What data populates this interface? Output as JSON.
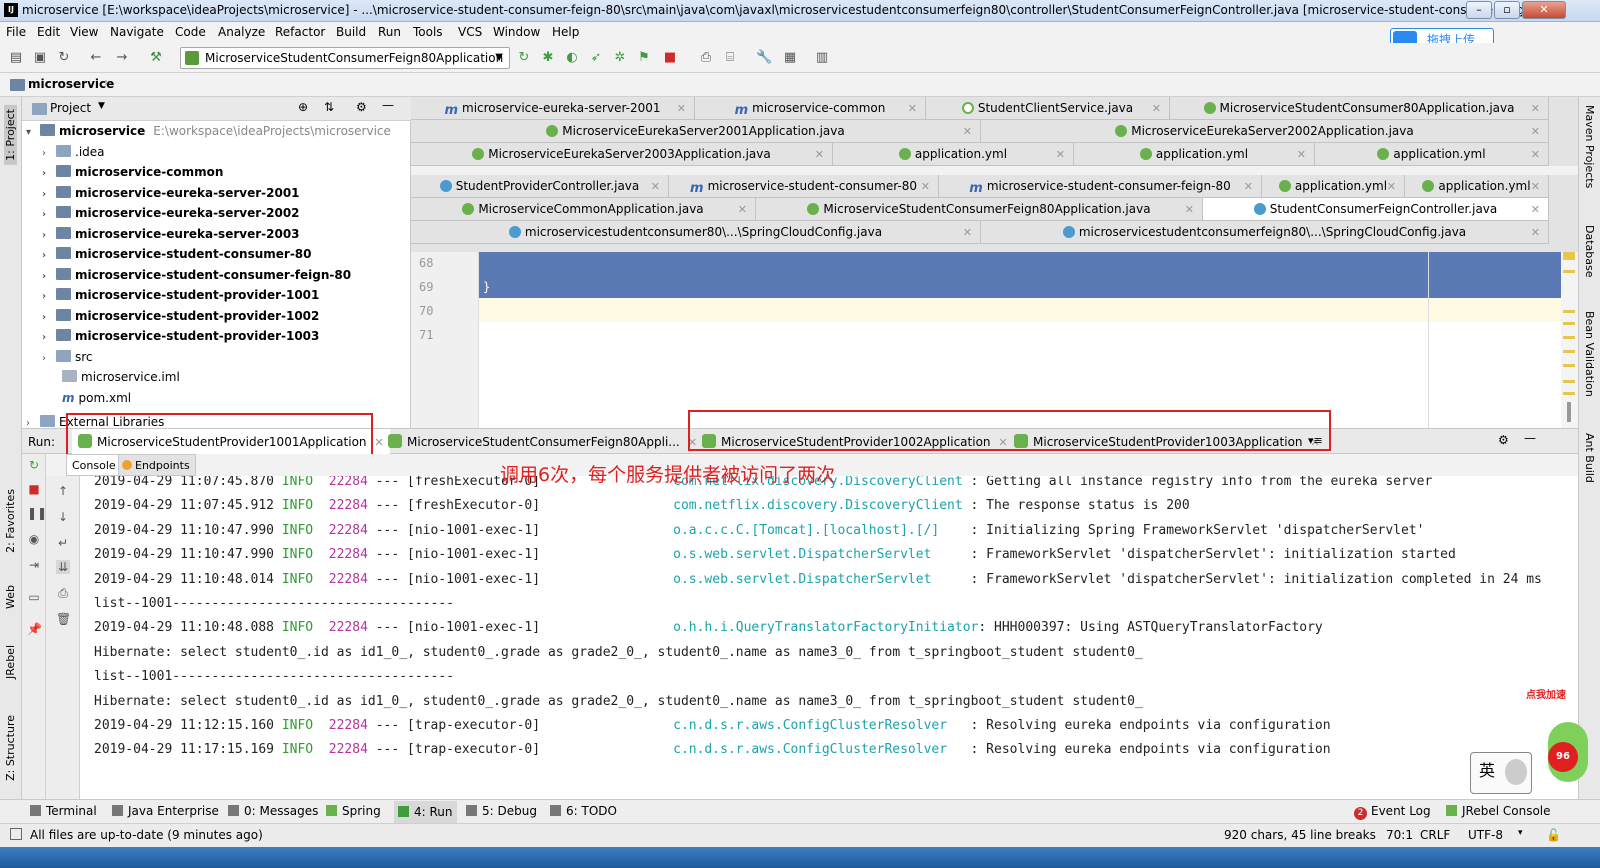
{
  "window": {
    "title": "microservice [E:\\workspace\\ideaProjects\\microservice] - ...\\microservice-student-consumer-feign-80\\src\\main\\java\\com\\javaxl\\microservicestudentconsumerfeign80\\controller\\StudentConsumerFeignController.java [microservice-student-consumer-feign...",
    "controls": {
      "minimize": "–",
      "restore": "▫",
      "close": "✕"
    }
  },
  "menu": [
    "File",
    "Edit",
    "View",
    "Navigate",
    "Code",
    "Analyze",
    "Refactor",
    "Build",
    "Run",
    "Tools",
    "VCS",
    "Window",
    "Help"
  ],
  "upload_button": "拖拽上传",
  "toolbar": {
    "run_config": "MicroserviceStudentConsumerFeign80Application"
  },
  "breadcrumb": "microservice",
  "left_strip": {
    "project": "1: Project",
    "favorites": "2: Favorites",
    "web": "Web",
    "jrebel": "JRebel",
    "structure": "Z: Structure"
  },
  "right_strip": {
    "maven": "Maven Projects",
    "database": "Database",
    "bean": "Bean Validation",
    "ant": "Ant Build"
  },
  "project_panel": {
    "title": "Project",
    "root": {
      "name": "microservice",
      "path": "E:\\workspace\\ideaProjects\\microservice"
    },
    "items": [
      {
        "name": ".idea",
        "bold": false,
        "expandable": true
      },
      {
        "name": "microservice-common",
        "bold": true,
        "expandable": true
      },
      {
        "name": "microservice-eureka-server-2001",
        "bold": true,
        "expandable": true
      },
      {
        "name": "microservice-eureka-server-2002",
        "bold": true,
        "expandable": true
      },
      {
        "name": "microservice-eureka-server-2003",
        "bold": true,
        "expandable": true
      },
      {
        "name": "microservice-student-consumer-80",
        "bold": true,
        "expandable": true
      },
      {
        "name": "microservice-student-consumer-feign-80",
        "bold": true,
        "expandable": true
      },
      {
        "name": "microservice-student-provider-1001",
        "bold": true,
        "expandable": true
      },
      {
        "name": "microservice-student-provider-1002",
        "bold": true,
        "expandable": true
      },
      {
        "name": "microservice-student-provider-1003",
        "bold": true,
        "expandable": true
      },
      {
        "name": "src",
        "bold": false,
        "expandable": true
      },
      {
        "name": "microservice.iml",
        "bold": false,
        "expandable": false
      },
      {
        "name": "pom.xml",
        "bold": false,
        "expandable": false
      }
    ],
    "external": "External Libraries"
  },
  "editor_tabs": {
    "row1": [
      {
        "label": "microservice-eureka-server-2001",
        "icon": "m"
      },
      {
        "label": "microservice-common",
        "icon": "m"
      },
      {
        "label": "StudentClientService.java",
        "icon": "i"
      },
      {
        "label": "MicroserviceStudentConsumer80Application.java",
        "icon": "spring"
      }
    ],
    "row2": [
      {
        "label": "MicroserviceEurekaServer2001Application.java",
        "icon": "spring"
      },
      {
        "label": "MicroserviceEurekaServer2002Application.java",
        "icon": "spring"
      }
    ],
    "row3": [
      {
        "label": "MicroserviceEurekaServer2003Application.java",
        "icon": "spring"
      },
      {
        "label": "application.yml",
        "icon": "yml"
      },
      {
        "label": "application.yml",
        "icon": "yml"
      },
      {
        "label": "application.yml",
        "icon": "yml"
      }
    ],
    "row4": [
      {
        "label": "StudentProviderController.java",
        "icon": "c"
      },
      {
        "label": "microservice-student-consumer-80",
        "icon": "m"
      },
      {
        "label": "microservice-student-consumer-feign-80",
        "icon": "m"
      },
      {
        "label": "application.yml",
        "icon": "yml"
      },
      {
        "label": "application.yml",
        "icon": "yml"
      }
    ],
    "row5": [
      {
        "label": "MicroserviceCommonApplication.java",
        "icon": "spring"
      },
      {
        "label": "MicroserviceStudentConsumerFeign80Application.java",
        "icon": "spring"
      },
      {
        "label": "StudentConsumerFeignController.java",
        "icon": "c"
      }
    ],
    "row6": [
      {
        "label": "microservicestudentconsumer80\\...\\SpringCloudConfig.java",
        "icon": "c"
      },
      {
        "label": "microservicestudentconsumerfeign80\\...\\SpringCloudConfig.java",
        "icon": "c"
      }
    ]
  },
  "editor": {
    "lines": [
      "68",
      "69",
      "70",
      "71"
    ],
    "code_69": "}"
  },
  "run_panel": {
    "label": "Run:",
    "tabs": [
      "MicroserviceStudentProvider1001Application",
      "MicroserviceStudentConsumerFeign80Appli...",
      "MicroserviceStudentProvider1002Application",
      "MicroserviceStudentProvider1003Application"
    ],
    "subtabs": [
      "Console",
      "Endpoints"
    ]
  },
  "annotation": "调用6次，每个服务提供者被访问了两次",
  "console": [
    {
      "date": "2019-04-29 11:07:45.870",
      "level": "INFO",
      "pid": "22284",
      "sep": "---",
      "thread": "[freshExecutor-0]",
      "logger": "com.netflix.discovery.DiscoveryClient",
      "msg": ": Getting all instance registry info from the eureka server"
    },
    {
      "date": "2019-04-29 11:07:45.912",
      "level": "INFO",
      "pid": "22284",
      "sep": "---",
      "thread": "[freshExecutor-0]",
      "logger": "com.netflix.discovery.DiscoveryClient",
      "msg": ": The response status is 200"
    },
    {
      "date": "2019-04-29 11:10:47.990",
      "level": "INFO",
      "pid": "22284",
      "sep": "---",
      "thread": "[nio-1001-exec-1]",
      "logger": "o.a.c.c.C.[Tomcat].[localhost].[/]",
      "msg": ": Initializing Spring FrameworkServlet 'dispatcherServlet'"
    },
    {
      "date": "2019-04-29 11:10:47.990",
      "level": "INFO",
      "pid": "22284",
      "sep": "---",
      "thread": "[nio-1001-exec-1]",
      "logger": "o.s.web.servlet.DispatcherServlet",
      "msg": ": FrameworkServlet 'dispatcherServlet': initialization started"
    },
    {
      "date": "2019-04-29 11:10:48.014",
      "level": "INFO",
      "pid": "22284",
      "sep": "---",
      "thread": "[nio-1001-exec-1]",
      "logger": "o.s.web.servlet.DispatcherServlet",
      "msg": ": FrameworkServlet 'dispatcherServlet': initialization completed in 24 ms"
    },
    {
      "plain": "list--1001------------------------------------"
    },
    {
      "date": "2019-04-29 11:10:48.088",
      "level": "INFO",
      "pid": "22284",
      "sep": "---",
      "thread": "[nio-1001-exec-1]",
      "logger": "o.h.h.i.QueryTranslatorFactoryInitiator",
      "msg": ": HHH000397: Using ASTQueryTranslatorFactory"
    },
    {
      "plain": "Hibernate: select student0_.id as id1_0_, student0_.grade as grade2_0_, student0_.name as name3_0_ from t_springboot_student student0_"
    },
    {
      "plain": "list--1001------------------------------------"
    },
    {
      "plain": "Hibernate: select student0_.id as id1_0_, student0_.grade as grade2_0_, student0_.name as name3_0_ from t_springboot_student student0_"
    },
    {
      "date": "2019-04-29 11:12:15.160",
      "level": "INFO",
      "pid": "22284",
      "sep": "---",
      "thread": "[trap-executor-0]",
      "logger": "c.n.d.s.r.aws.ConfigClusterResolver",
      "msg": ": Resolving eureka endpoints via configuration"
    },
    {
      "date": "2019-04-29 11:17:15.169",
      "level": "INFO",
      "pid": "22284",
      "sep": "---",
      "thread": "[trap-executor-0]",
      "logger": "c.n.d.s.r.aws.ConfigClusterResolver",
      "msg": ": Resolving eureka endpoints via configuration"
    }
  ],
  "bottom_tools": {
    "left": [
      "Terminal",
      "Java Enterprise",
      "0: Messages",
      "Spring",
      "4: Run",
      "5: Debug",
      "6: TODO"
    ],
    "right": [
      "Event Log",
      "JRebel Console"
    ],
    "event_count": "2"
  },
  "status": {
    "message": "All files are up-to-date (9 minutes ago)",
    "chars": "920 chars, 45 line breaks",
    "pos": "70:1",
    "line_sep": "CRLF",
    "encoding": "UTF-8"
  },
  "ime": {
    "char": "英"
  },
  "overlay": {
    "speed_label": "点我加速",
    "speed_value": "96"
  },
  "colors": {
    "selection": "#5a79b5",
    "info": "#2e9e2e",
    "pid": "#b3349d",
    "logger": "#1aa3b0",
    "annotation": "#e02020"
  }
}
